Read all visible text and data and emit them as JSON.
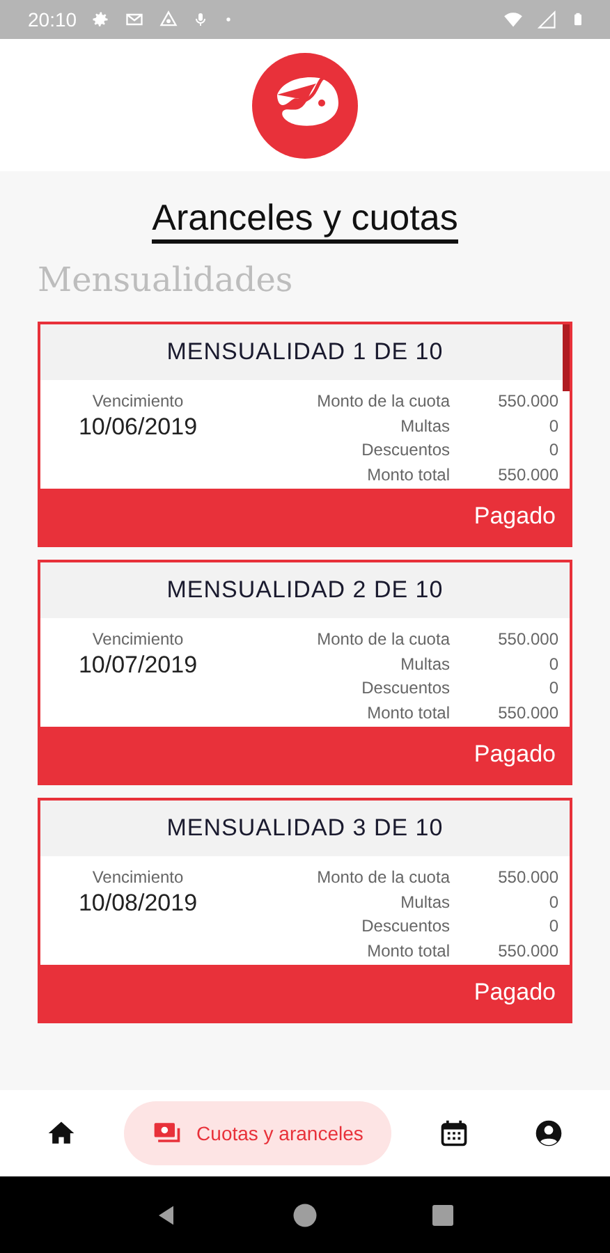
{
  "status_bar": {
    "time": "20:10"
  },
  "page": {
    "title": "Aranceles y cuotas",
    "section": "Mensualidades"
  },
  "installments": [
    {
      "title": "MENSUALIDAD 1 DE 10",
      "due_label": "Vencimiento",
      "due_date": "10/06/2019",
      "lines": [
        {
          "label": "Monto de la cuota",
          "value": "550.000"
        },
        {
          "label": "Multas",
          "value": "0"
        },
        {
          "label": "Descuentos",
          "value": "0"
        },
        {
          "label": "Monto total",
          "value": "550.000"
        }
      ],
      "status": "Pagado"
    },
    {
      "title": "MENSUALIDAD 2 DE 10",
      "due_label": "Vencimiento",
      "due_date": "10/07/2019",
      "lines": [
        {
          "label": "Monto de la cuota",
          "value": "550.000"
        },
        {
          "label": "Multas",
          "value": "0"
        },
        {
          "label": "Descuentos",
          "value": "0"
        },
        {
          "label": "Monto total",
          "value": "550.000"
        }
      ],
      "status": "Pagado"
    },
    {
      "title": "MENSUALIDAD 3 DE 10",
      "due_label": "Vencimiento",
      "due_date": "10/08/2019",
      "lines": [
        {
          "label": "Monto de la cuota",
          "value": "550.000"
        },
        {
          "label": "Multas",
          "value": "0"
        },
        {
          "label": "Descuentos",
          "value": "0"
        },
        {
          "label": "Monto total",
          "value": "550.000"
        }
      ],
      "status": "Pagado"
    }
  ],
  "bottom_nav": [
    {
      "kind": "home",
      "selected": false
    },
    {
      "kind": "fees",
      "label": "Cuotas y aranceles",
      "selected": true
    },
    {
      "kind": "calendar",
      "selected": false
    },
    {
      "kind": "profile",
      "selected": false
    }
  ]
}
